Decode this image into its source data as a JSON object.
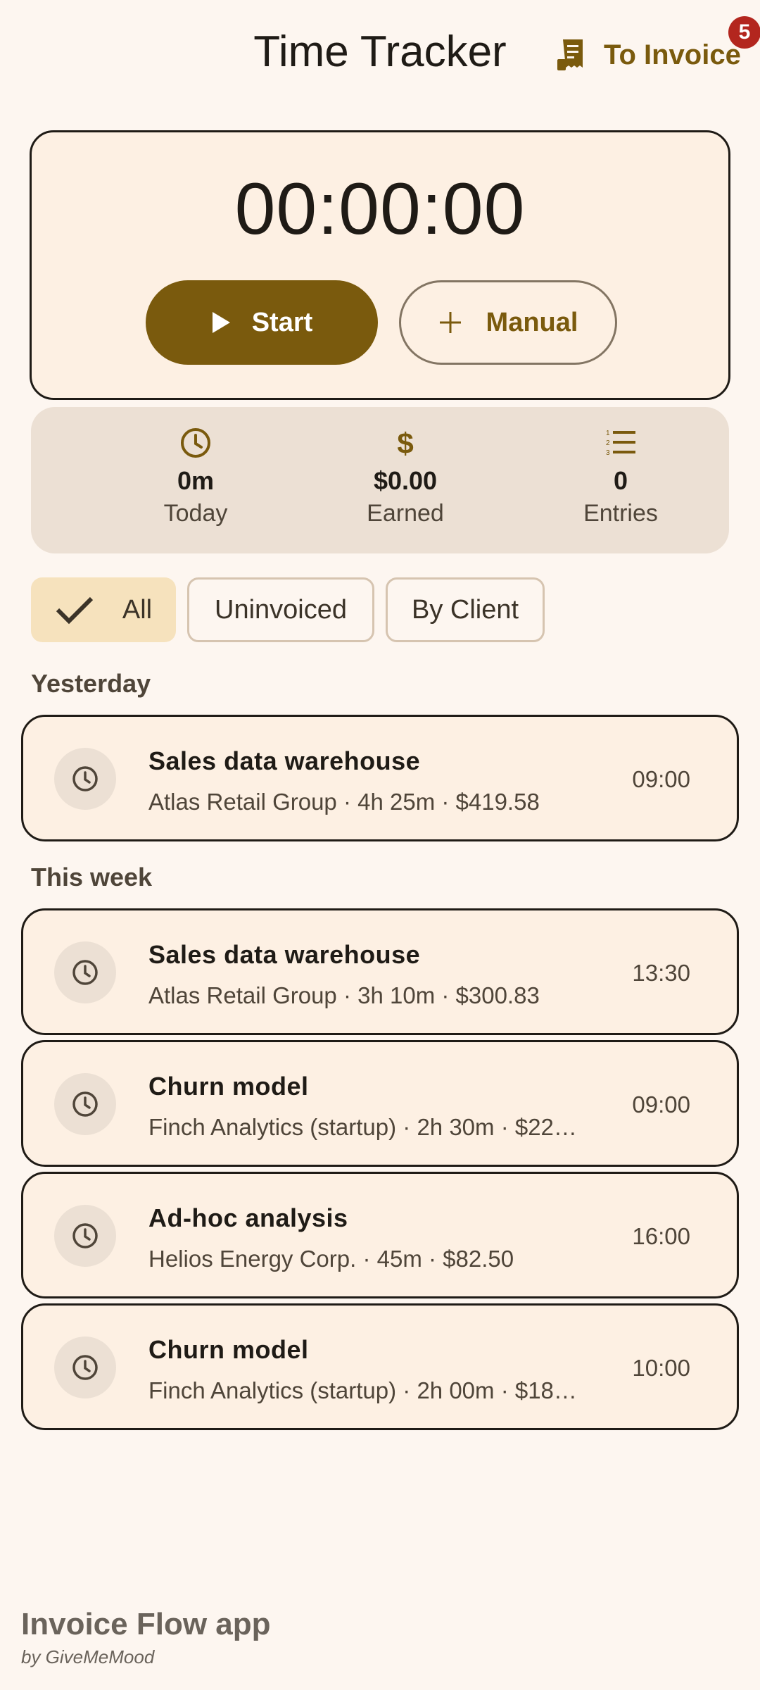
{
  "header": {
    "title": "Time Tracker",
    "to_invoice_label": "To Invoice",
    "to_invoice_count": "5"
  },
  "timer": {
    "value": "00:00:00",
    "start_label": "Start",
    "manual_label": "Manual"
  },
  "stats": {
    "today": {
      "value": "0m",
      "label": "Today",
      "icon": "clock-icon"
    },
    "earned": {
      "value": "$0.00",
      "label": "Earned",
      "icon": "dollar-icon"
    },
    "entries": {
      "value": "0",
      "label": "Entries",
      "icon": "list-numbered-icon"
    }
  },
  "filters": {
    "all": "All",
    "uninvoiced": "Uninvoiced",
    "by_client": "By Client",
    "selected": "All"
  },
  "sections": [
    {
      "label": "Yesterday",
      "entries": [
        {
          "title": "Sales data warehouse",
          "subtitle": "Atlas Retail Group · 4h 25m · $419.58",
          "time": "09:00"
        }
      ]
    },
    {
      "label": "This week",
      "entries": [
        {
          "title": "Sales data warehouse",
          "subtitle": "Atlas Retail Group · 3h 10m · $300.83",
          "time": "13:30"
        },
        {
          "title": "Churn model",
          "subtitle": "Finch Analytics (startup) · 2h 30m · $22…",
          "time": "09:00"
        },
        {
          "title": "Ad-hoc analysis",
          "subtitle": "Helios Energy Corp. · 45m · $82.50",
          "time": "16:00"
        },
        {
          "title": "Churn model",
          "subtitle": "Finch Analytics (startup) · 2h 00m · $18…",
          "time": "10:00"
        }
      ]
    }
  ],
  "footer": {
    "title": "Invoice Flow app",
    "byline": "by GiveMeMood"
  },
  "colors": {
    "background": "#fdf6f0",
    "accent": "#7a5a0d",
    "card": "#fdf0e3",
    "chip_selected": "#f6e2bd",
    "badge": "#b3261e"
  }
}
